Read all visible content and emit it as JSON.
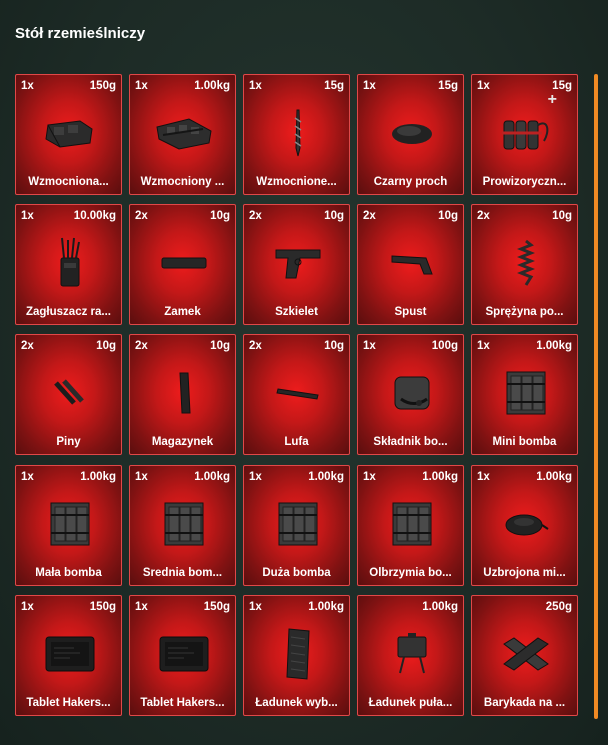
{
  "window": {
    "title": "Stół rzemieślniczy"
  },
  "colors": {
    "slot_accent": "#e02020",
    "scrollbar": "#f08a24",
    "background": "#1d2b26"
  },
  "items": [
    {
      "qty": "1x",
      "weight": "150g",
      "name": "Wzmocniona...",
      "icon": "armor-plate-icon"
    },
    {
      "qty": "1x",
      "weight": "1.00kg",
      "name": "Wzmocniony ...",
      "icon": "armor-vest-icon"
    },
    {
      "qty": "1x",
      "weight": "15g",
      "name": "Wzmocnione...",
      "icon": "drill-bit-icon"
    },
    {
      "qty": "1x",
      "weight": "15g",
      "name": "Czarny proch",
      "icon": "gunpowder-icon"
    },
    {
      "qty": "1x",
      "weight": "15g",
      "name": "Prowizoryczn...",
      "icon": "improvised-bomb-icon"
    },
    {
      "qty": "1x",
      "weight": "10.00kg",
      "name": "Zagłuszacz ra...",
      "icon": "radio-jammer-icon"
    },
    {
      "qty": "2x",
      "weight": "10g",
      "name": "Zamek",
      "icon": "slide-icon"
    },
    {
      "qty": "2x",
      "weight": "10g",
      "name": "Szkielet",
      "icon": "pistol-frame-icon"
    },
    {
      "qty": "2x",
      "weight": "10g",
      "name": "Spust",
      "icon": "trigger-icon"
    },
    {
      "qty": "2x",
      "weight": "10g",
      "name": "Sprężyna po...",
      "icon": "spring-icon"
    },
    {
      "qty": "2x",
      "weight": "10g",
      "name": "Piny",
      "icon": "pins-icon"
    },
    {
      "qty": "2x",
      "weight": "10g",
      "name": "Magazynek",
      "icon": "magazine-icon"
    },
    {
      "qty": "2x",
      "weight": "10g",
      "name": "Lufa",
      "icon": "barrel-icon"
    },
    {
      "qty": "1x",
      "weight": "100g",
      "name": "Składnik bo...",
      "icon": "bomb-component-icon"
    },
    {
      "qty": "1x",
      "weight": "1.00kg",
      "name": "Mini bomba",
      "icon": "c4-bomb-icon"
    },
    {
      "qty": "1x",
      "weight": "1.00kg",
      "name": "Mała bomba",
      "icon": "c4-bomb-icon"
    },
    {
      "qty": "1x",
      "weight": "1.00kg",
      "name": "Średnia bom...",
      "icon": "c4-bomb-icon"
    },
    {
      "qty": "1x",
      "weight": "1.00kg",
      "name": "Duża bomba",
      "icon": "c4-bomb-icon"
    },
    {
      "qty": "1x",
      "weight": "1.00kg",
      "name": "Olbrzymia bo...",
      "icon": "c4-bomb-icon"
    },
    {
      "qty": "1x",
      "weight": "1.00kg",
      "name": "Uzbrojona mi...",
      "icon": "landmine-icon"
    },
    {
      "qty": "1x",
      "weight": "150g",
      "name": "Tablet Hakers...",
      "icon": "tablet-icon"
    },
    {
      "qty": "1x",
      "weight": "150g",
      "name": "Tablet Hakers...",
      "icon": "tablet-icon"
    },
    {
      "qty": "1x",
      "weight": "1.00kg",
      "name": "Ładunek wyb...",
      "icon": "explosive-charge-icon"
    },
    {
      "qty": "",
      "weight": "1.00kg",
      "name": "Ładunek puła...",
      "icon": "claymore-icon"
    },
    {
      "qty": "",
      "weight": "250g",
      "name": "Barykada na ...",
      "icon": "barricade-icon"
    }
  ]
}
